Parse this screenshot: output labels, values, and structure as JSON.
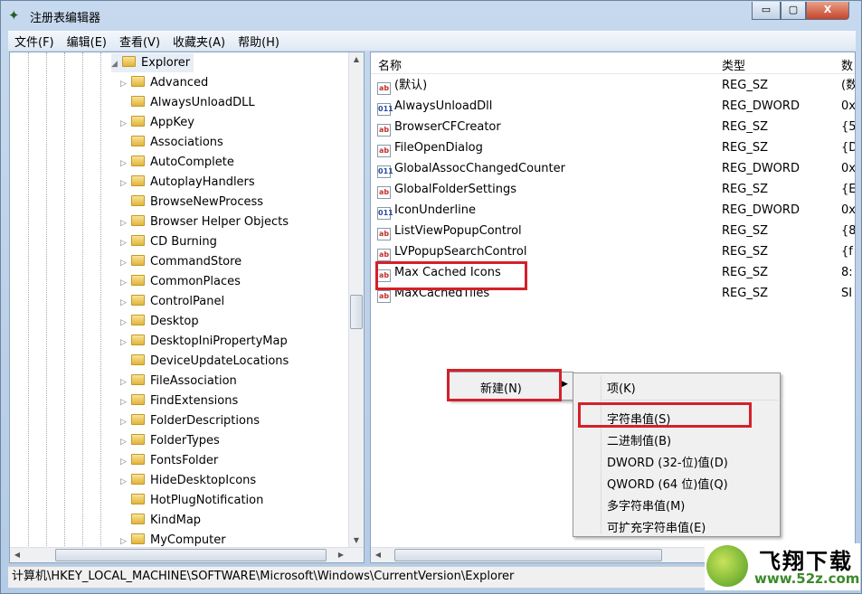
{
  "window": {
    "title": "注册表编辑器",
    "buttons": [
      "minimize",
      "maximize",
      "close"
    ]
  },
  "menu": [
    "文件(F)",
    "编辑(E)",
    "查看(V)",
    "收藏夹(A)",
    "帮助(H)"
  ],
  "tree": {
    "selected": "Explorer",
    "children": [
      {
        "label": "Advanced",
        "expandable": true
      },
      {
        "label": "AlwaysUnloadDLL",
        "expandable": false
      },
      {
        "label": "AppKey",
        "expandable": true
      },
      {
        "label": "Associations",
        "expandable": false
      },
      {
        "label": "AutoComplete",
        "expandable": true
      },
      {
        "label": "AutoplayHandlers",
        "expandable": true
      },
      {
        "label": "BrowseNewProcess",
        "expandable": false
      },
      {
        "label": "Browser Helper Objects",
        "expandable": true
      },
      {
        "label": "CD Burning",
        "expandable": true
      },
      {
        "label": "CommandStore",
        "expandable": true
      },
      {
        "label": "CommonPlaces",
        "expandable": true
      },
      {
        "label": "ControlPanel",
        "expandable": true
      },
      {
        "label": "Desktop",
        "expandable": true
      },
      {
        "label": "DesktopIniPropertyMap",
        "expandable": true
      },
      {
        "label": "DeviceUpdateLocations",
        "expandable": false
      },
      {
        "label": "FileAssociation",
        "expandable": true
      },
      {
        "label": "FindExtensions",
        "expandable": true
      },
      {
        "label": "FolderDescriptions",
        "expandable": true
      },
      {
        "label": "FolderTypes",
        "expandable": true
      },
      {
        "label": "FontsFolder",
        "expandable": true
      },
      {
        "label": "HideDesktopIcons",
        "expandable": true
      },
      {
        "label": "HotPlugNotification",
        "expandable": false
      },
      {
        "label": "KindMap",
        "expandable": false
      },
      {
        "label": "MyComputer",
        "expandable": true
      }
    ]
  },
  "list": {
    "headers": [
      "名称",
      "类型",
      "数"
    ],
    "rows": [
      {
        "name": "(默认)",
        "type": "REG_SZ",
        "data": "(数",
        "icon": "string-value-icon"
      },
      {
        "name": "AlwaysUnloadDll",
        "type": "REG_DWORD",
        "data": "0x",
        "icon": "dword-value-icon"
      },
      {
        "name": "BrowserCFCreator",
        "type": "REG_SZ",
        "data": "{5",
        "icon": "string-value-icon"
      },
      {
        "name": "FileOpenDialog",
        "type": "REG_SZ",
        "data": "{D",
        "icon": "string-value-icon"
      },
      {
        "name": "GlobalAssocChangedCounter",
        "type": "REG_DWORD",
        "data": "0x",
        "icon": "dword-value-icon"
      },
      {
        "name": "GlobalFolderSettings",
        "type": "REG_SZ",
        "data": "{E",
        "icon": "string-value-icon"
      },
      {
        "name": "IconUnderline",
        "type": "REG_DWORD",
        "data": "0x",
        "icon": "dword-value-icon"
      },
      {
        "name": "ListViewPopupControl",
        "type": "REG_SZ",
        "data": "{8",
        "icon": "string-value-icon"
      },
      {
        "name": "LVPopupSearchControl",
        "type": "REG_SZ",
        "data": "{f",
        "icon": "string-value-icon"
      },
      {
        "name": "Max Cached Icons",
        "type": "REG_SZ",
        "data": "8:",
        "icon": "string-value-icon",
        "highlighted": true
      },
      {
        "name": "MaxCachedTiles",
        "type": "REG_SZ",
        "data": "SI",
        "icon": "string-value-icon"
      }
    ]
  },
  "context_menu": {
    "new": "新建(N)"
  },
  "submenu": [
    "项(K)",
    "字符串值(S)",
    "二进制值(B)",
    "DWORD (32-位)值(D)",
    "QWORD (64 位)值(Q)",
    "多字符串值(M)",
    "可扩充字符串值(E)"
  ],
  "status": "计算机\\HKEY_LOCAL_MACHINE\\SOFTWARE\\Microsoft\\Windows\\CurrentVersion\\Explorer",
  "watermark": {
    "brand": "飞翔下载",
    "url": "www.52z.com"
  },
  "colors": {
    "highlight_box": "#d4202a"
  }
}
